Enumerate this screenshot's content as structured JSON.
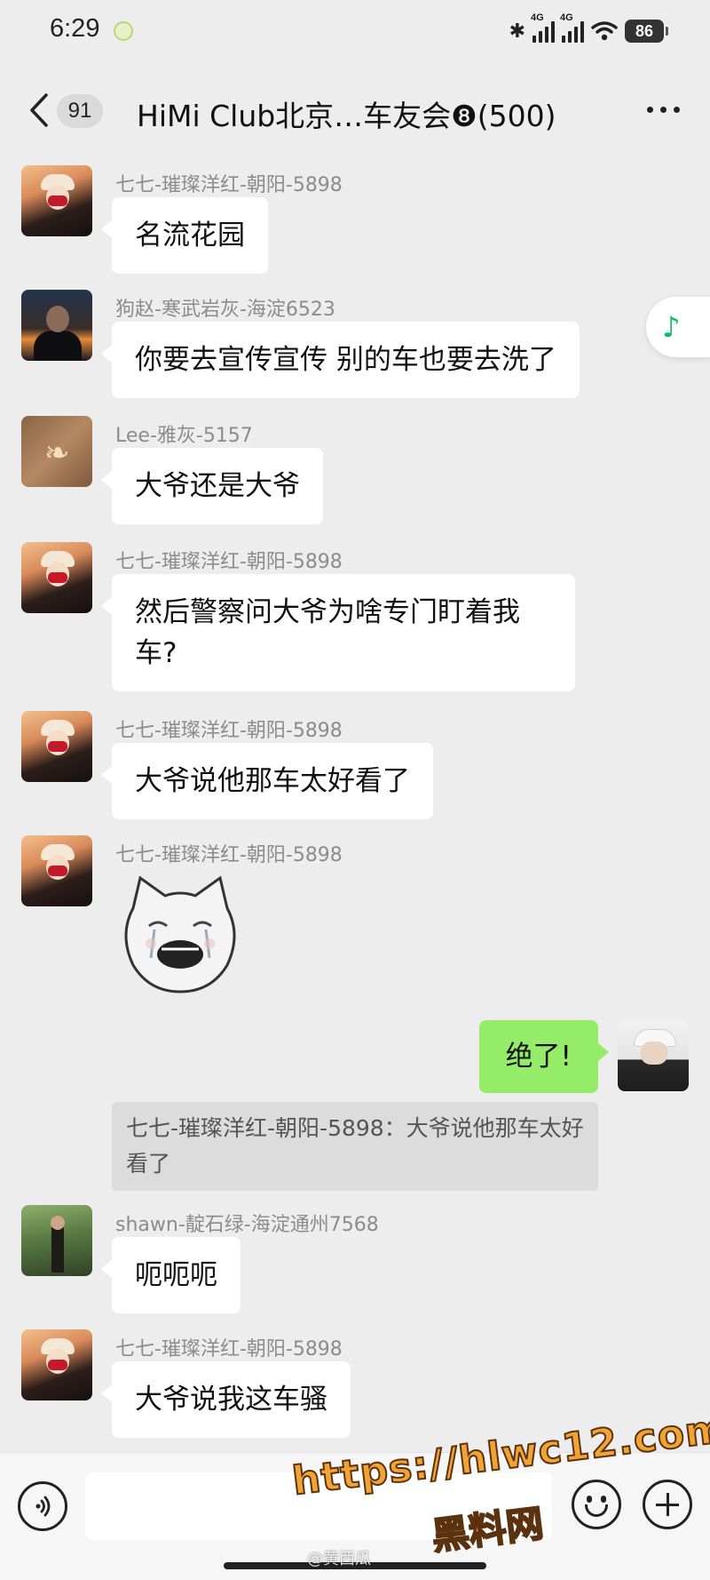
{
  "status_bar": {
    "time": "6:29",
    "bluetooth_icon": "bluetooth-icon",
    "signal1_label": "4G",
    "signal2_label": "4G",
    "battery": "86"
  },
  "nav": {
    "unread_count": "91",
    "title": "HiMi Club北京…车友会❽(500)"
  },
  "messages": [
    {
      "sender": "七七-璀璨洋红-朝阳-5898",
      "text": "名流花园"
    },
    {
      "sender": "狗赵-寒武岩灰-海淀6523",
      "text": "你要去宣传宣传 别的车也要去洗了"
    },
    {
      "sender": "Lee-雅灰-5157",
      "text": "大爷还是大爷"
    },
    {
      "sender": "七七-璀璨洋红-朝阳-5898",
      "text": "然后警察问大爷为啥专门盯着我车?"
    },
    {
      "sender": "七七-璀璨洋红-朝阳-5898",
      "text": "大爷说他那车太好看了"
    },
    {
      "sender": "七七-璀璨洋红-朝阳-5898",
      "sticker": "crying-cat-sticker"
    },
    {
      "self": true,
      "text": "绝了!",
      "quote": "七七-璀璨洋红-朝阳-5898：大爷说他那车太好看了"
    },
    {
      "sender": "shawn-靛石绿-海淀通州7568",
      "text": "呃呃呃"
    },
    {
      "sender": "七七-璀璨洋红-朝阳-5898",
      "text": "大爷说我这车骚"
    }
  ],
  "input": {
    "placeholder": ""
  },
  "watermark": {
    "url": "https://hlwc12.com",
    "name": "黑料网",
    "weibo": "@黄西瓜"
  },
  "colors": {
    "background": "#ededed",
    "self_bubble": "#95ec69",
    "accent": "#07c160"
  }
}
